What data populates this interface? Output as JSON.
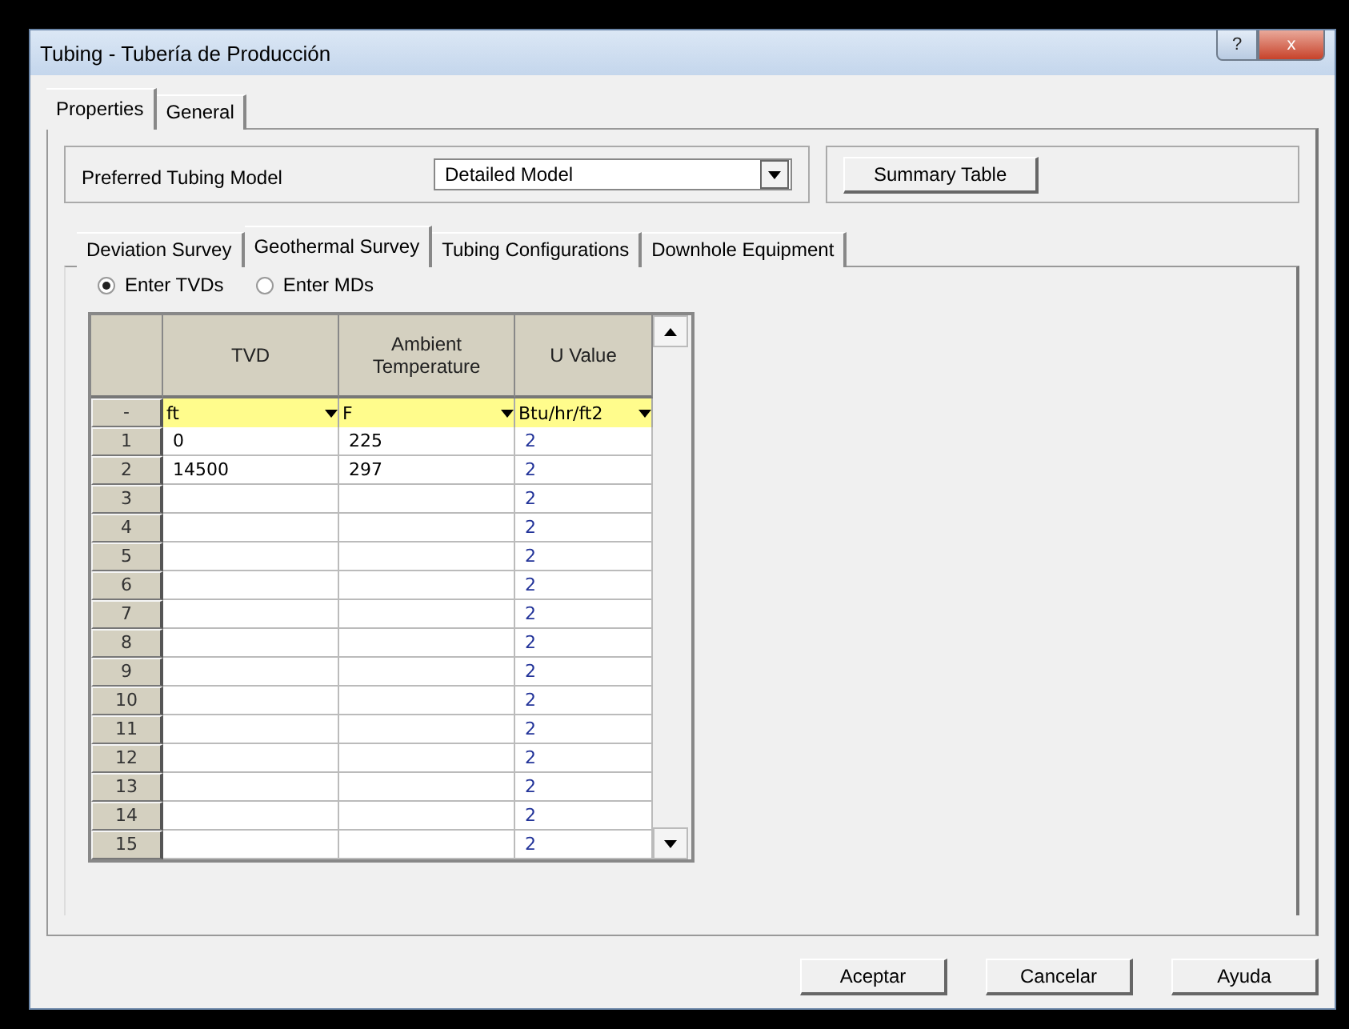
{
  "window": {
    "title": "Tubing - Tubería de Producción",
    "help_button": "?",
    "close_button": "x"
  },
  "tabs": [
    {
      "label": "Properties",
      "selected": true
    },
    {
      "label": "General",
      "selected": false
    }
  ],
  "preferred_model": {
    "label": "Preferred Tubing Model",
    "value": "Detailed Model"
  },
  "summary_button": "Summary Table",
  "sub_tabs": [
    {
      "label": "Deviation Survey",
      "selected": false
    },
    {
      "label": "Geothermal Survey",
      "selected": true
    },
    {
      "label": "Tubing Configurations",
      "selected": false
    },
    {
      "label": "Downhole Equipment",
      "selected": false
    }
  ],
  "radio_options": [
    {
      "label": "Enter TVDs",
      "selected": true
    },
    {
      "label": "Enter MDs",
      "selected": false
    }
  ],
  "table": {
    "columns": [
      {
        "title": "TVD",
        "unit": "ft"
      },
      {
        "title": "Ambient Temperature",
        "unit": "F"
      },
      {
        "title": "U Value",
        "unit": "Btu/hr/ft2"
      }
    ],
    "unit_row_label": "-",
    "rows": [
      {
        "number": "1",
        "cells": [
          "0",
          "225",
          "2"
        ]
      },
      {
        "number": "2",
        "cells": [
          "14500",
          "297",
          "2"
        ]
      },
      {
        "number": "3",
        "cells": [
          null,
          null,
          "2"
        ]
      },
      {
        "number": "4",
        "cells": [
          null,
          null,
          "2"
        ]
      },
      {
        "number": "5",
        "cells": [
          null,
          null,
          "2"
        ]
      },
      {
        "number": "6",
        "cells": [
          null,
          null,
          "2"
        ]
      },
      {
        "number": "7",
        "cells": [
          null,
          null,
          "2"
        ]
      },
      {
        "number": "8",
        "cells": [
          null,
          null,
          "2"
        ]
      },
      {
        "number": "9",
        "cells": [
          null,
          null,
          "2"
        ]
      },
      {
        "number": "10",
        "cells": [
          null,
          null,
          "2"
        ]
      },
      {
        "number": "11",
        "cells": [
          null,
          null,
          "2"
        ]
      },
      {
        "number": "12",
        "cells": [
          null,
          null,
          "2"
        ]
      },
      {
        "number": "13",
        "cells": [
          null,
          null,
          "2"
        ]
      },
      {
        "number": "14",
        "cells": [
          null,
          null,
          "2"
        ]
      },
      {
        "number": "15",
        "cells": [
          null,
          null,
          "2"
        ]
      }
    ]
  },
  "buttons": [
    "Aceptar",
    "Cancelar",
    "Ayuda"
  ]
}
